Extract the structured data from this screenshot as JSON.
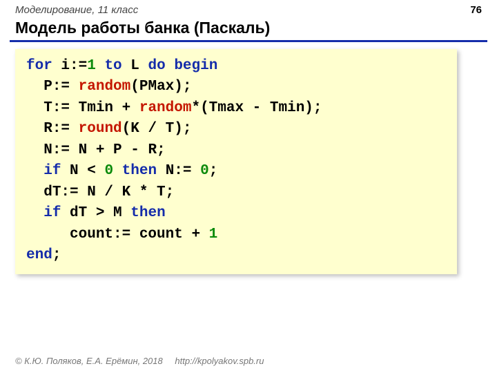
{
  "header": {
    "course": "Моделирование, 11 класс",
    "page": "76"
  },
  "title": "Модель работы банка (Паскаль)",
  "code": {
    "lines": [
      {
        "indent": "",
        "tokens": [
          {
            "cls": "kw",
            "t": "for"
          },
          {
            "cls": "op",
            "t": " i:="
          },
          {
            "cls": "num",
            "t": "1"
          },
          {
            "cls": "op",
            "t": " "
          },
          {
            "cls": "kw",
            "t": "to"
          },
          {
            "cls": "op",
            "t": " L "
          },
          {
            "cls": "kw",
            "t": "do"
          },
          {
            "cls": "op",
            "t": " "
          },
          {
            "cls": "kw",
            "t": "begin"
          }
        ]
      },
      {
        "indent": "  ",
        "tokens": [
          {
            "cls": "op",
            "t": "P:= "
          },
          {
            "cls": "fn",
            "t": "random"
          },
          {
            "cls": "op",
            "t": "(PMax);"
          }
        ]
      },
      {
        "indent": "  ",
        "tokens": [
          {
            "cls": "op",
            "t": "T:= Tmin + "
          },
          {
            "cls": "fn",
            "t": "random"
          },
          {
            "cls": "op",
            "t": "*(Tmax - Tmin);"
          }
        ]
      },
      {
        "indent": "  ",
        "tokens": [
          {
            "cls": "op",
            "t": "R:= "
          },
          {
            "cls": "fn",
            "t": "round"
          },
          {
            "cls": "op",
            "t": "(K / T);"
          }
        ]
      },
      {
        "indent": "  ",
        "tokens": [
          {
            "cls": "op",
            "t": "N:= N + P - R;"
          }
        ]
      },
      {
        "indent": "  ",
        "tokens": [
          {
            "cls": "kw",
            "t": "if"
          },
          {
            "cls": "op",
            "t": " N < "
          },
          {
            "cls": "num",
            "t": "0"
          },
          {
            "cls": "op",
            "t": " "
          },
          {
            "cls": "kw",
            "t": "then"
          },
          {
            "cls": "op",
            "t": " N:= "
          },
          {
            "cls": "num",
            "t": "0"
          },
          {
            "cls": "op",
            "t": ";"
          }
        ]
      },
      {
        "indent": "  ",
        "tokens": [
          {
            "cls": "op",
            "t": "dT:= N / K * T;"
          }
        ]
      },
      {
        "indent": "  ",
        "tokens": [
          {
            "cls": "kw",
            "t": "if"
          },
          {
            "cls": "op",
            "t": " dT > M "
          },
          {
            "cls": "kw",
            "t": "then"
          }
        ]
      },
      {
        "indent": "     ",
        "tokens": [
          {
            "cls": "op",
            "t": "count:= count + "
          },
          {
            "cls": "num",
            "t": "1"
          }
        ]
      },
      {
        "indent": "",
        "tokens": [
          {
            "cls": "kw",
            "t": "end"
          },
          {
            "cls": "op",
            "t": ";"
          }
        ]
      }
    ]
  },
  "footer": {
    "copyright": "© К.Ю. Поляков, Е.А. Ерёмин, 2018",
    "url": "http://kpolyakov.spb.ru"
  }
}
